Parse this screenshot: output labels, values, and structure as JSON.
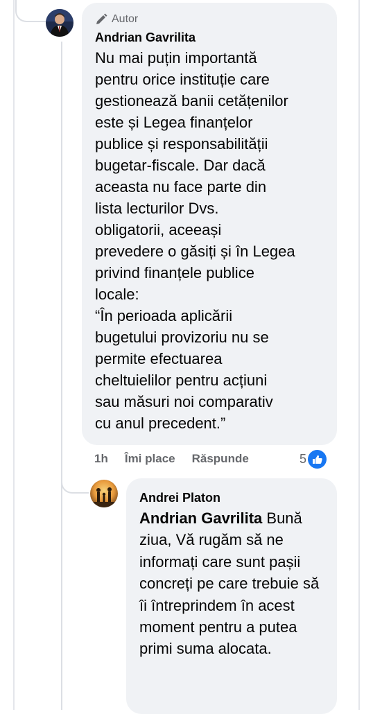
{
  "comment": {
    "badge": "Autor",
    "author": "Andrian Gavrilita",
    "text": "Nu mai puțin importantă\npentru orice instituție care\ngestionează banii cetățenilor\neste și Legea finanțelor\npublice și responsabilității\nbugetar-fiscale. Dar dacă\naceasta nu face parte din\nlista lecturilor Dvs.\nobligatorii, aceeași\nprevedere o găsiți și în Legea\nprivind finanțele publice\nlocale:\n“În perioada aplicării\nbugetului provizoriu nu se\npermite efectuarea\ncheltuielilor pentru acțiuni\nsau măsuri noi comparativ\ncu anul precedent.”",
    "time": "1h",
    "like_label": "Îmi place",
    "reply_label": "Răspunde",
    "reaction_count": "5"
  },
  "reply": {
    "author": "Andrei Platon",
    "mention": "Andrian Gavrilita",
    "text": " Bună ziua,\nVă rugăm să ne informați care sunt pașii concreți pe care trebuie să îi întreprindem în acest moment pentru a putea primi suma alocata."
  },
  "colors": {
    "bubble": "#f0f2f5",
    "muted": "#65676b",
    "like_blue": "#1877f2"
  }
}
